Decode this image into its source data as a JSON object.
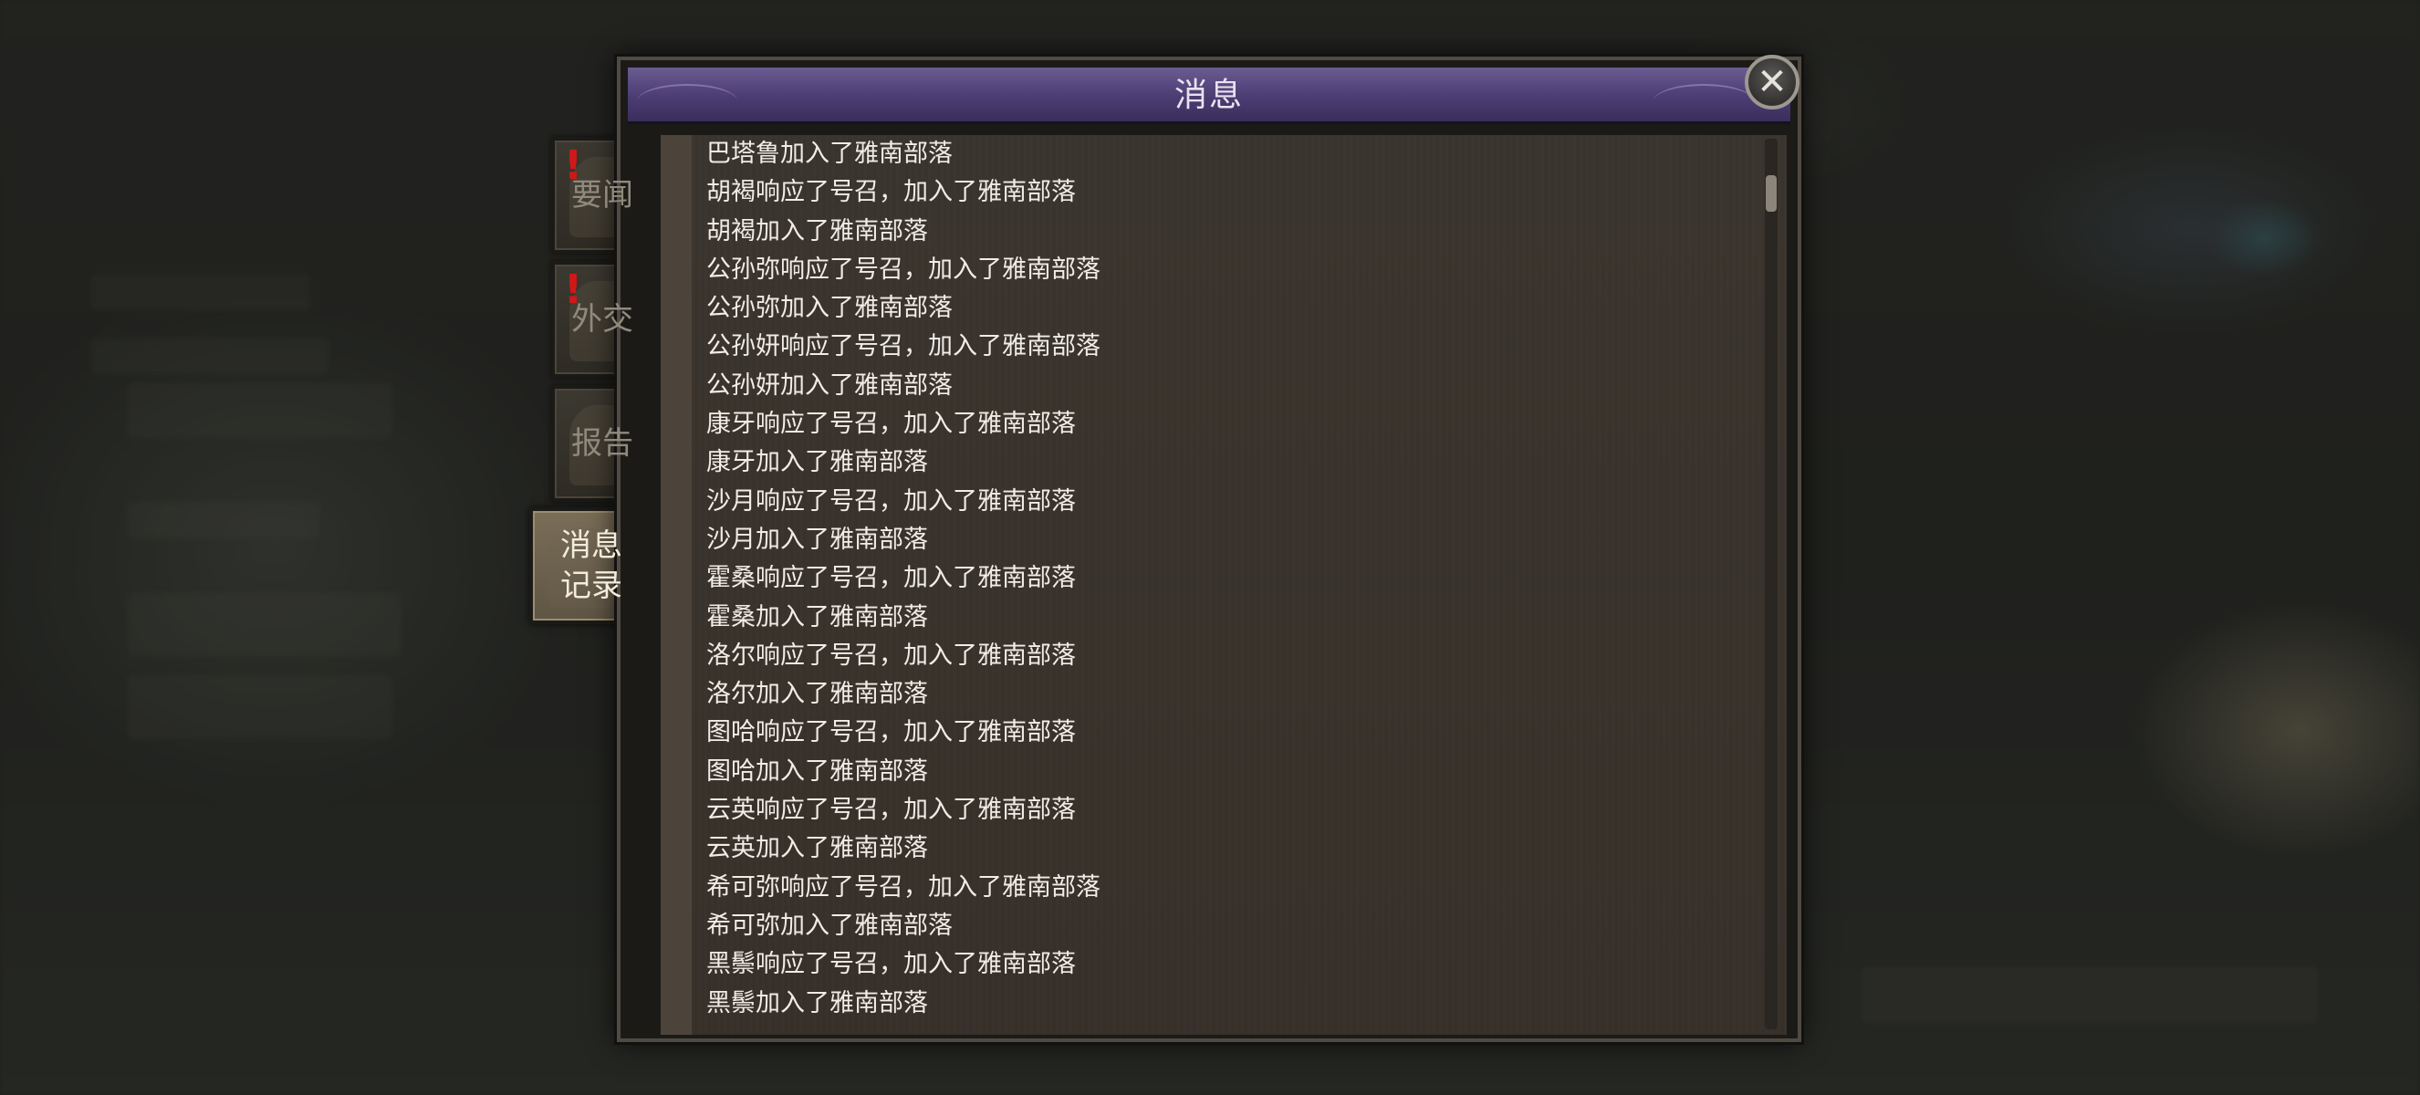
{
  "dialog": {
    "title": "消息",
    "close_icon": "close-icon"
  },
  "tabs": [
    {
      "label": "要闻",
      "alert": true,
      "active": false
    },
    {
      "label": "外交",
      "alert": true,
      "active": false
    },
    {
      "label": "报告",
      "alert": false,
      "active": false
    },
    {
      "label": "消息\n记录",
      "alert": false,
      "active": true
    }
  ],
  "messages": [
    "巴塔鲁加入了雅南部落",
    "胡褐响应了号召，加入了雅南部落",
    "胡褐加入了雅南部落",
    "公孙弥响应了号召，加入了雅南部落",
    "公孙弥加入了雅南部落",
    "公孙妍响应了号召，加入了雅南部落",
    "公孙妍加入了雅南部落",
    "康牙响应了号召，加入了雅南部落",
    "康牙加入了雅南部落",
    "沙月响应了号召，加入了雅南部落",
    "沙月加入了雅南部落",
    "霍桑响应了号召，加入了雅南部落",
    "霍桑加入了雅南部落",
    "洛尔响应了号召，加入了雅南部落",
    "洛尔加入了雅南部落",
    "图哈响应了号召，加入了雅南部落",
    "图哈加入了雅南部落",
    "云英响应了号召，加入了雅南部落",
    "云英加入了雅南部落",
    "希可弥响应了号召，加入了雅南部落",
    "希可弥加入了雅南部落",
    "黑鬃响应了号召，加入了雅南部落",
    "黑鬃加入了雅南部落"
  ],
  "colors": {
    "title_bar": "#4b3d72",
    "alert": "#d01818",
    "panel": "#3a342e",
    "text": "#f1ede6"
  }
}
